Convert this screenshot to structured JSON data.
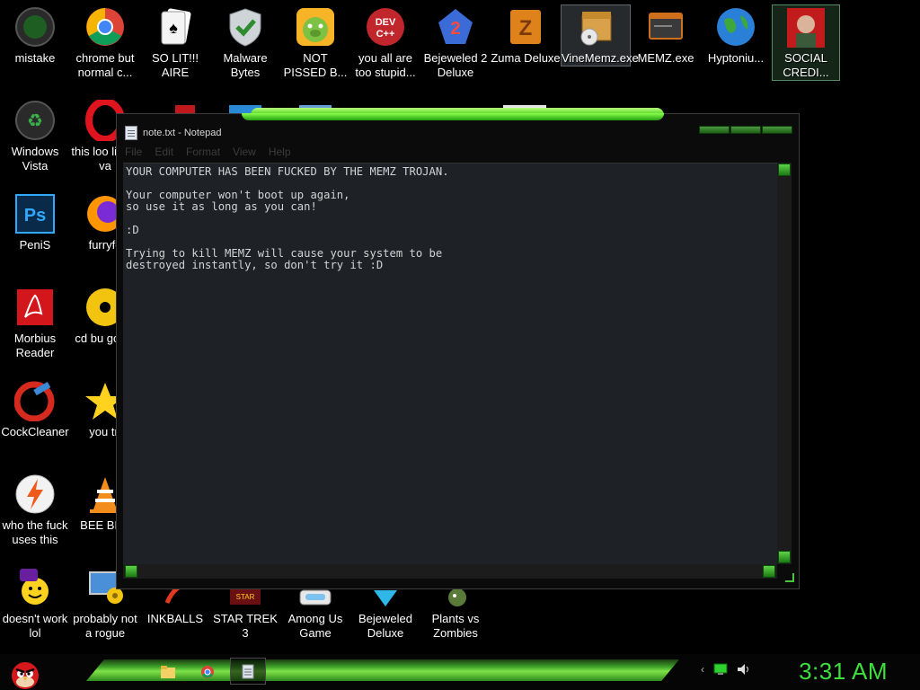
{
  "desktop": {
    "icons": [
      {
        "label": "mistake"
      },
      {
        "label": "chrome but normal c..."
      },
      {
        "label": "SO LIT!!! AIRE"
      },
      {
        "label": "Malware Bytes"
      },
      {
        "label": "NOT PISSED B..."
      },
      {
        "label": "you all are too stupid..."
      },
      {
        "label": "Bejeweled 2 Deluxe"
      },
      {
        "label": "Zuma Deluxe"
      },
      {
        "label": "VineMemz.exe"
      },
      {
        "label": "MEMZ.exe"
      },
      {
        "label": "Hyptoniu..."
      },
      {
        "label": "SOCIAL CREDI..."
      },
      {
        "label": "Windows Vista"
      },
      {
        "label": "this loo like a va"
      },
      {
        "label": "PeniS"
      },
      {
        "label": "furryfo"
      },
      {
        "label": "Morbius Reader"
      },
      {
        "label": "cd bu golde"
      },
      {
        "label": "CockCleaner"
      },
      {
        "label": "you tri"
      },
      {
        "label": "who the fuck uses this"
      },
      {
        "label": "BEE BEE"
      },
      {
        "label": "doesn't work lol"
      },
      {
        "label": "probably not a rogue"
      },
      {
        "label": "INKBALLS"
      },
      {
        "label": "STAR TREK 3"
      },
      {
        "label": "Among Us Game"
      },
      {
        "label": "Bejeweled Deluxe"
      },
      {
        "label": "Plants vs Zombies"
      }
    ]
  },
  "notepad": {
    "title": "note.txt - Notepad",
    "menu": [
      "File",
      "Edit",
      "Format",
      "View",
      "Help"
    ],
    "content": "YOUR COMPUTER HAS BEEN FUCKED BY THE MEMZ TROJAN.\n\nYour computer won't boot up again,\nso use it as long as you can!\n\n:D\n\nTrying to kill MEMZ will cause your system to be\ndestroyed instantly, so don't try it :D"
  },
  "taskbar": {
    "clock": "3:31 AM"
  },
  "colors": {
    "accent_green": "#3ddf3d",
    "window_bg": "#1e2226",
    "editor_text": "#cfd4d6"
  }
}
